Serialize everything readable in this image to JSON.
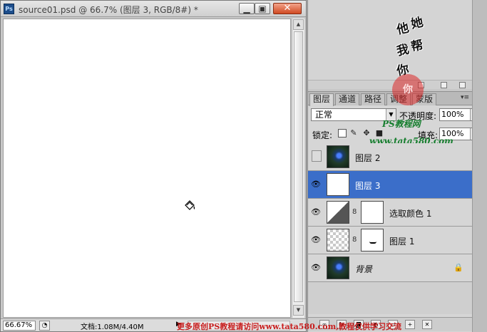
{
  "document": {
    "ps_logo": "Ps",
    "title": "source01.psd @ 66.7% (图层 3, RGB/8#) *",
    "min_glyph": "▁",
    "max_glyph": "▣",
    "close_glyph": "✕",
    "zoom": "66.67%",
    "doc_info": "文档:1.08M/4.40M",
    "status_arrow": "▶"
  },
  "watermark": {
    "top_chars": [
      "他",
      "她",
      "我",
      "帮",
      "你"
    ],
    "seal": "你",
    "ps_site": "PS教程网",
    "url": "www.tata580.com",
    "bottom": "更多原创PS教程请访问www.tata580.com,教程仅供学习交流"
  },
  "layers_panel": {
    "tabs": [
      "图层",
      "通道",
      "路径",
      "调整",
      "蒙版"
    ],
    "active_tab": "图层",
    "blend_mode": "正常",
    "opacity_label": "不透明度:",
    "opacity": "100%",
    "lock_label": "锁定:",
    "fill_label": "填充:",
    "fill": "100%",
    "layers": [
      {
        "name": "图层 2",
        "visible": false,
        "selected": false,
        "thumb": "photo",
        "mask": false
      },
      {
        "name": "图层 3",
        "visible": true,
        "selected": true,
        "thumb": "white",
        "mask": false
      },
      {
        "name": "选取颜色 1",
        "visible": true,
        "selected": false,
        "thumb": "adjust",
        "mask": true
      },
      {
        "name": "图层 1",
        "visible": true,
        "selected": false,
        "thumb": "checker",
        "mask": true
      },
      {
        "name": "背景",
        "visible": true,
        "selected": false,
        "thumb": "photo",
        "mask": false,
        "locked": true
      }
    ]
  },
  "icons": {
    "eye": "👁",
    "chain": "8",
    "lock": "🔒",
    "dropdown": "▼",
    "step_right": "▶",
    "menu": "▾≡"
  }
}
